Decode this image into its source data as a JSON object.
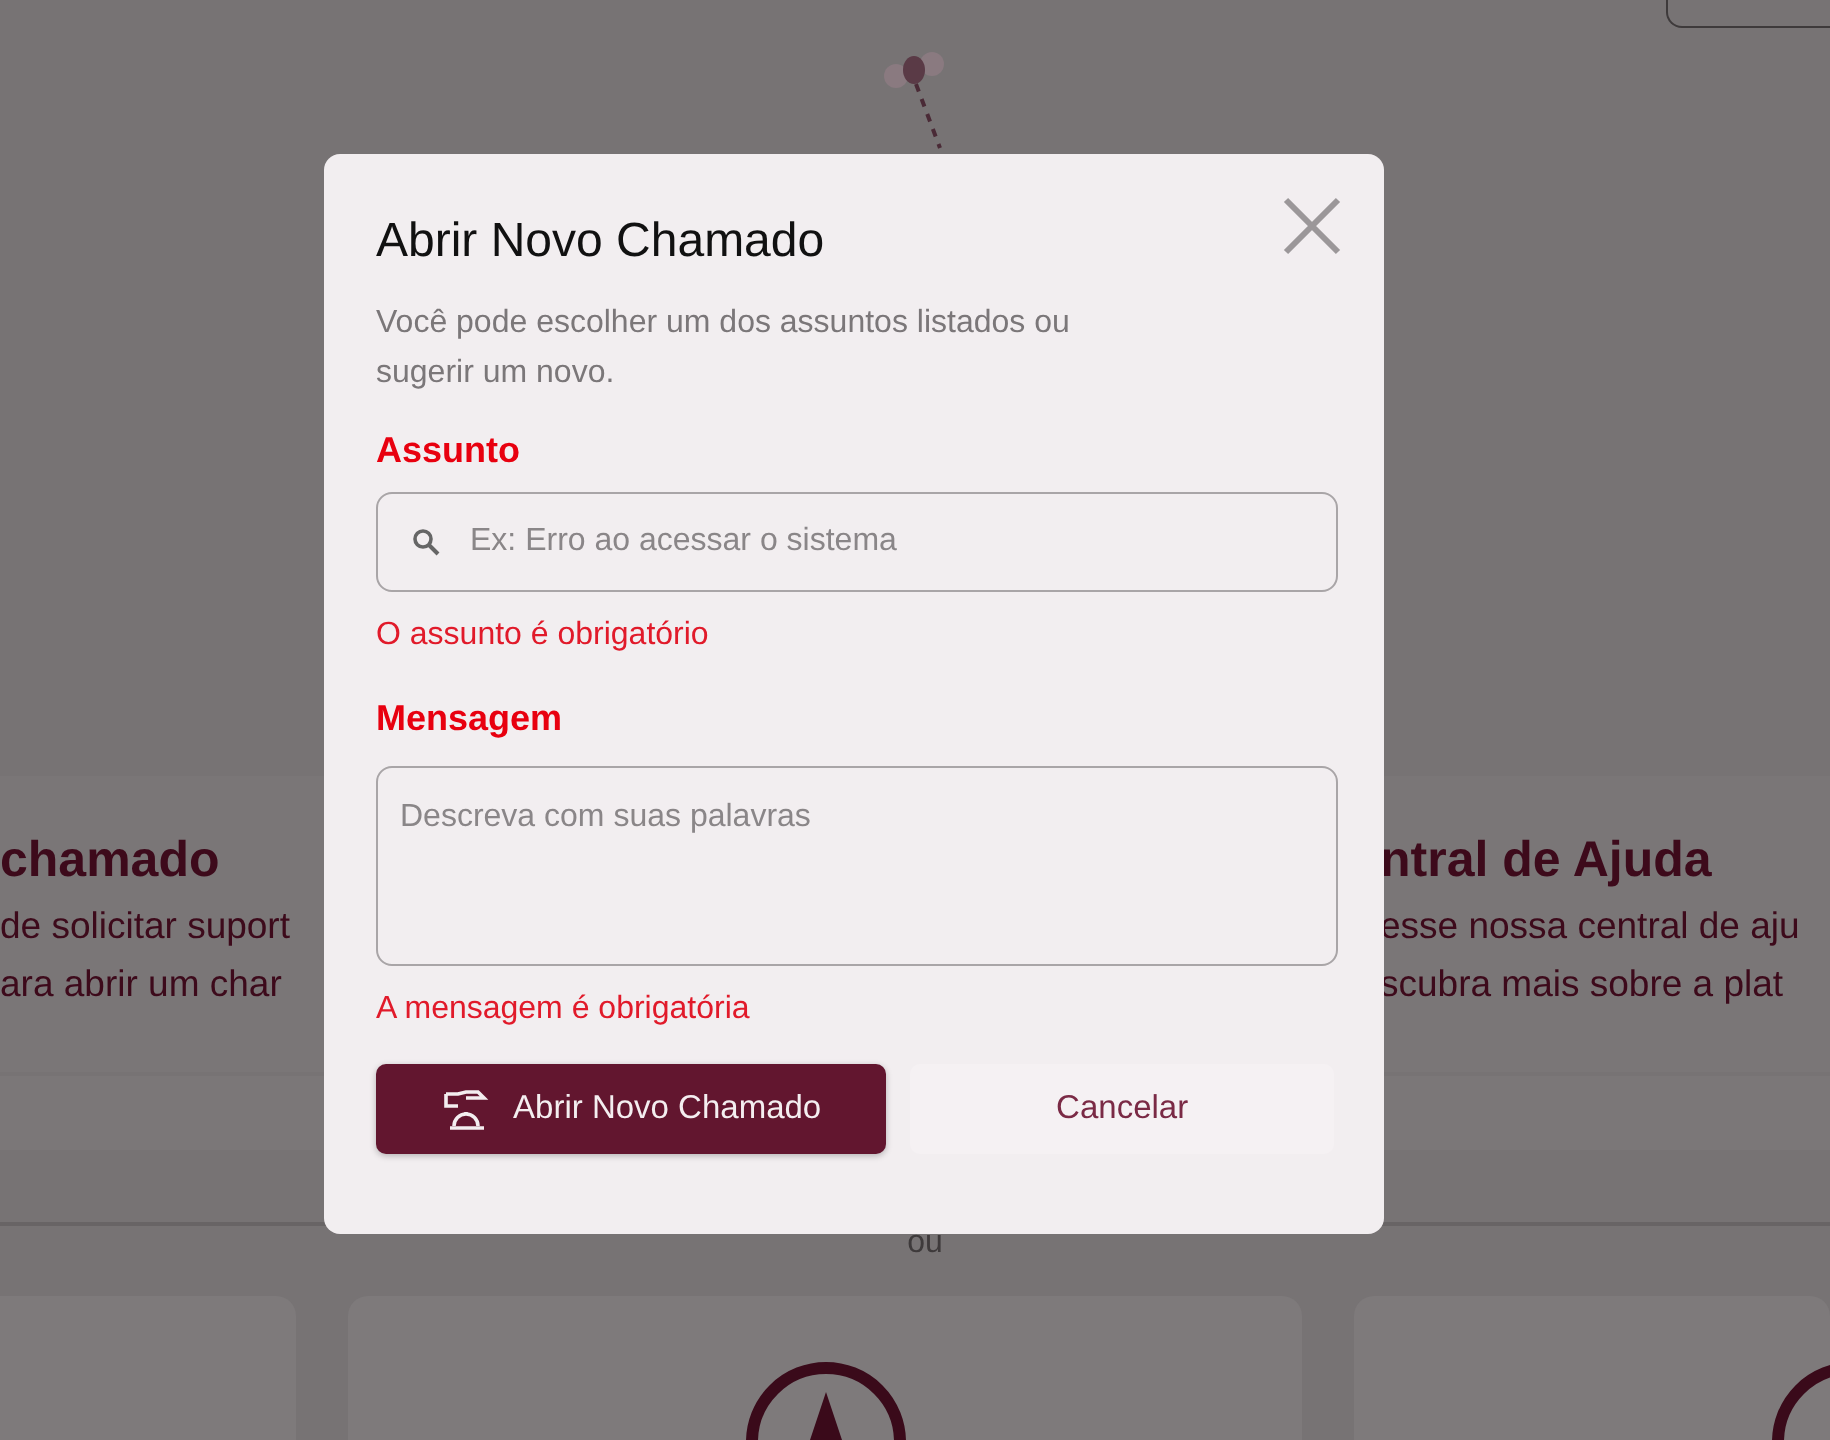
{
  "background": {
    "left_card": {
      "title": "chamado",
      "lines": [
        "de solicitar suport",
        "ara abrir um char"
      ]
    },
    "right_card": {
      "title": "ntral de Ajuda",
      "lines": [
        "esse nossa central de aju",
        "scubra mais sobre a plat"
      ]
    },
    "divider_label": "ou"
  },
  "modal": {
    "title": "Abrir Novo Chamado",
    "description": "Você pode escolher um dos assuntos listados ou sugerir um novo.",
    "fields": [
      {
        "kind": "search",
        "label": "Assunto",
        "placeholder": "Ex: Erro ao acessar o sistema",
        "error": "O assunto é obrigatório"
      },
      {
        "kind": "textarea",
        "label": "Mensagem",
        "placeholder": "Descreva com suas palavras",
        "error": "A mensagem é obrigatória"
      }
    ],
    "buttons": [
      {
        "kind": "primary",
        "label": "Abrir Novo Chamado"
      },
      {
        "kind": "secondary",
        "label": "Cancelar"
      }
    ]
  }
}
